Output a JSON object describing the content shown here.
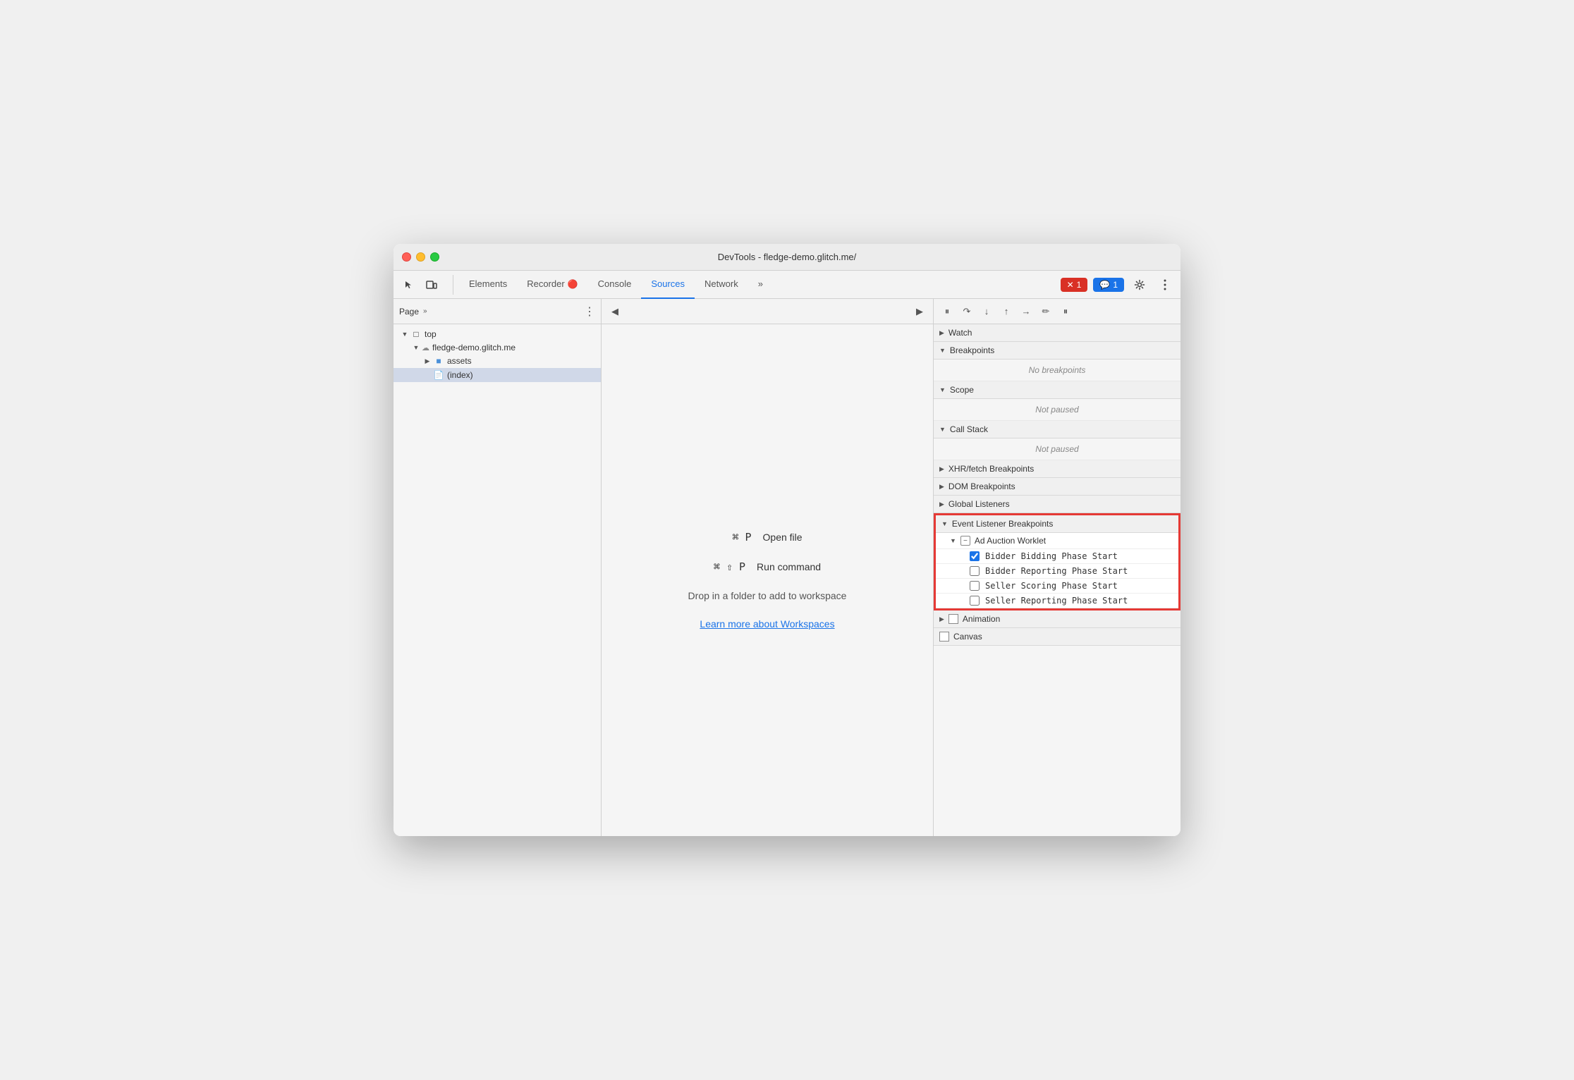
{
  "window": {
    "title": "DevTools - fledge-demo.glitch.me/"
  },
  "traffic_lights": {
    "red": "close",
    "yellow": "minimize",
    "green": "maximize"
  },
  "toolbar": {
    "tabs": [
      {
        "label": "Elements",
        "active": false
      },
      {
        "label": "Recorder",
        "active": false
      },
      {
        "label": "Console",
        "active": false
      },
      {
        "label": "Sources",
        "active": true
      },
      {
        "label": "Network",
        "active": false
      }
    ],
    "more_tabs_label": "»",
    "error_badge": "1",
    "info_badge": "1"
  },
  "file_panel": {
    "title": "Page",
    "chevron": "»",
    "tree": [
      {
        "label": "top",
        "indent": 1,
        "type": "root",
        "expanded": true
      },
      {
        "label": "fledge-demo.glitch.me",
        "indent": 2,
        "type": "domain",
        "expanded": true
      },
      {
        "label": "assets",
        "indent": 3,
        "type": "folder",
        "expanded": false
      },
      {
        "label": "(index)",
        "indent": 3,
        "type": "file",
        "selected": true
      }
    ]
  },
  "editor_panel": {
    "shortcuts": [
      {
        "key": "⌘ P",
        "label": "Open file"
      },
      {
        "key": "⌘ ⇧ P",
        "label": "Run command"
      }
    ],
    "workspace_text": "Drop in a folder to add to workspace",
    "workspace_link": "Learn more about Workspaces"
  },
  "debugger_panel": {
    "sections": [
      {
        "label": "Watch",
        "expanded": false,
        "arrow": "▶"
      },
      {
        "label": "Breakpoints",
        "expanded": true,
        "arrow": "▼",
        "content": "No breakpoints"
      },
      {
        "label": "Scope",
        "expanded": true,
        "arrow": "▼",
        "content": "Not paused"
      },
      {
        "label": "Call Stack",
        "expanded": true,
        "arrow": "▼",
        "content": "Not paused"
      },
      {
        "label": "XHR/fetch Breakpoints",
        "expanded": false,
        "arrow": "▶"
      },
      {
        "label": "DOM Breakpoints",
        "expanded": false,
        "arrow": "▶"
      },
      {
        "label": "Global Listeners",
        "expanded": false,
        "arrow": "▶"
      },
      {
        "label": "Event Listener Breakpoints",
        "expanded": true,
        "arrow": "▼",
        "highlighted": true
      }
    ],
    "event_listener": {
      "ad_auction": {
        "label": "Ad Auction Worklet",
        "expanded": true,
        "items": [
          {
            "label": "Bidder Bidding Phase Start",
            "checked": true
          },
          {
            "label": "Bidder Reporting Phase Start",
            "checked": false
          },
          {
            "label": "Seller Scoring Phase Start",
            "checked": false
          },
          {
            "label": "Seller Reporting Phase Start",
            "checked": false
          }
        ]
      },
      "animation": {
        "label": "Animation",
        "expanded": false
      },
      "canvas": {
        "label": "Canvas",
        "expanded": false
      }
    }
  }
}
